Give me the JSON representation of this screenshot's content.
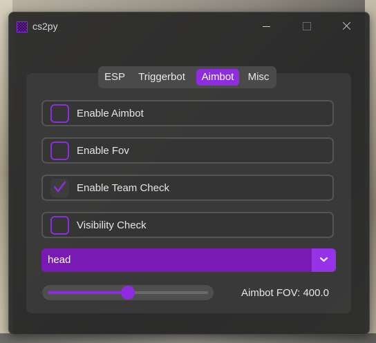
{
  "window": {
    "title": "cs2py"
  },
  "tabs": [
    {
      "label": "ESP",
      "active": false
    },
    {
      "label": "Triggerbot",
      "active": false
    },
    {
      "label": "Aimbot",
      "active": true
    },
    {
      "label": "Misc",
      "active": false
    }
  ],
  "options": [
    {
      "label": "Enable Aimbot",
      "checked": false
    },
    {
      "label": "Enable Fov",
      "checked": false
    },
    {
      "label": "Enable Team Check",
      "checked": true
    },
    {
      "label": "Visibility Check",
      "checked": false
    }
  ],
  "target_select": {
    "value": "head"
  },
  "fov_slider": {
    "label": "Aimbot FOV: 400.0",
    "fraction": 0.5
  },
  "colors": {
    "accent": "#8e2de0",
    "panel": "#3c3c3c"
  }
}
